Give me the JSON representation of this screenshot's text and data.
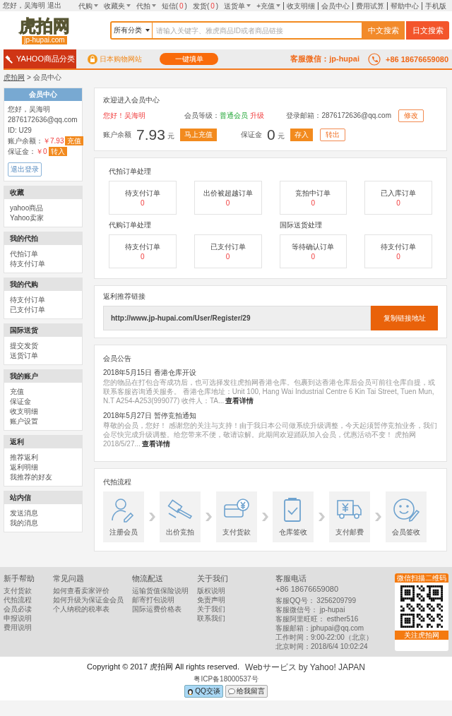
{
  "top_bar": {
    "greeting": "您好，吴海明",
    "logout": "退出",
    "menu": [
      {
        "kind": "dropdown",
        "label": "代购"
      },
      {
        "kind": "dropdown",
        "label": "收藏夹"
      },
      {
        "kind": "dropdown",
        "label": "代拍"
      },
      {
        "kind": "count",
        "label": "短信(",
        "count": "0",
        "close": ")"
      },
      {
        "kind": "count",
        "label": "发货(",
        "count": "0",
        "close": ")"
      },
      {
        "kind": "dropdown",
        "label": "送货单"
      },
      {
        "kind": "dropdown",
        "label": "+充值"
      },
      {
        "kind": "link",
        "label": "收支明细"
      },
      {
        "kind": "link",
        "label": "会员中心"
      },
      {
        "kind": "link",
        "label": "费用试算"
      },
      {
        "kind": "link",
        "label": "帮助中心"
      },
      {
        "kind": "link",
        "label": "手机版"
      }
    ]
  },
  "header": {
    "logo": {
      "name": "虎拍网",
      "domain": "jp-hupai.com"
    },
    "search": {
      "category": "所有分类",
      "placeholder": "请输入关键字、雅虎商品ID或者商品链接",
      "buttons": [
        "中文搜索",
        "日文搜索"
      ]
    }
  },
  "nav": {
    "category_button": "YAHOO商品分类",
    "shop_link": "日本购物网站",
    "quick_button": "一键填单",
    "wechat": "客服微信：jp-hupai",
    "phone": "+86 18676659080"
  },
  "breadcrumb": {
    "items": [
      "虎拍网",
      "会员中心"
    ],
    "separator": ">"
  },
  "sidebar": {
    "profile": {
      "title": "会员中心",
      "greeting": "您好，吴海明",
      "email": "2876172636@qq.com",
      "id": "ID: U29",
      "balance_label": "账户余额：",
      "balance": "￥7.93",
      "recharge": "充值",
      "deposit_label": "保证金：",
      "deposit": "￥0",
      "transfer": "转入",
      "logout": "退出登录"
    },
    "sections": [
      {
        "title": "收藏",
        "items": [
          "yahoo商品",
          "Yahoo卖家"
        ]
      },
      {
        "title": "我的代拍",
        "items": [
          "代拍订单",
          "待支付订单"
        ]
      },
      {
        "title": "我的代购",
        "items": [
          "待支付订单",
          "已支付订单"
        ]
      },
      {
        "title": "国际送货",
        "items": [
          "提交发货",
          "送货订单"
        ]
      },
      {
        "title": "我的账户",
        "items": [
          "充值",
          "保证金",
          "收支明细",
          "账户设置"
        ]
      },
      {
        "title": "返利",
        "items": [
          "推荐返利",
          "返利明细",
          "我推荐的好友"
        ]
      },
      {
        "title": "站内信",
        "items": [
          "发送消息",
          "我的消息"
        ]
      }
    ]
  },
  "welcome": {
    "title": "欢迎进入会员中心",
    "greeting": "您好！吴海明",
    "level_label": "会员等级：",
    "level": "普通会员",
    "upgrade": "升级",
    "email": "登录邮箱：2876172636@qq.com",
    "edit": "修改",
    "balance_label": "账户余额",
    "balance": "7.93",
    "balance_unit": "元",
    "recharge": "马上充值",
    "deposit_label": "保证金",
    "deposit": "0",
    "deposit_unit": "元",
    "deposit_in": "存入",
    "withdraw": "转出"
  },
  "orders": {
    "groups": [
      {
        "title": "代拍订单处理",
        "cards": [
          {
            "label": "待支付订单",
            "count": "0"
          },
          {
            "label": "出价被超越订单",
            "count": "0"
          },
          {
            "label": "竞拍中订单",
            "count": "0"
          },
          {
            "label": "已入库订单",
            "count": "0"
          }
        ]
      },
      {
        "title": "代购订单处理",
        "cards": [
          {
            "label": "待支付订单",
            "count": "0"
          },
          {
            "label": "已支付订单",
            "count": "0"
          }
        ]
      },
      {
        "title": "国际送货处理",
        "cards": [
          {
            "label": "等待确认订单",
            "count": "0"
          },
          {
            "label": "待支付订单",
            "count": "0"
          }
        ]
      }
    ]
  },
  "referral": {
    "title": "返利推荐链接",
    "link": "http://www.jp-hupai.com/User/Register/29",
    "copy_button": "复制链接地址"
  },
  "notices": {
    "title": "会员公告",
    "items": [
      {
        "title": "2018年5月15日 香港仓库开设",
        "body": "您的物品在打包合寄成功后，也可选择发往虎拍网香港仓库。包裹到达香港仓库后会员可前往仓库自提，或联系客服咨询通关服务。 香港仓库地址：Unit 100, Hang Wai Industrial Centre 6 Kin Tai Street, Tuen Mun, N.T A254-A253(999077)  收件人：TA...",
        "more": "查看详情"
      },
      {
        "title": "2018年5月27日 暂停竞拍通知",
        "body": "尊敬的会员，您好！ 感谢您的关注与支持！由于我日本公司做系统升级调整，今天起须暂停竞拍业务，我们会尽快完成升级调整。给您带来不便，敬请谅解。此期间欢迎踊跃加入会员，优惠活动不变！  虎拍网 2018/5/27...",
        "more": "查看详情"
      }
    ]
  },
  "process": {
    "title": "代拍流程",
    "steps": [
      "注册会员",
      "出价竞拍",
      "支付货款",
      "仓库签收",
      "支付邮费",
      "会员签收"
    ]
  },
  "footer": {
    "columns": [
      {
        "title": "新手帮助",
        "links": [
          "支付货款",
          "代拍流程",
          "会员必读",
          "申报说明",
          "费用说明"
        ]
      },
      {
        "title": "常见问题",
        "links": [
          "如何查看卖家评价",
          "如何升级为保证金会员",
          "个人纳税的税率表"
        ]
      },
      {
        "title": "物流配送",
        "links": [
          "运输货值保险说明",
          "邮寄打包说明",
          "国际运费价格表"
        ]
      },
      {
        "title": "关于我们",
        "links": [
          "版权说明",
          "免责声明",
          "关于我们",
          "联系我们"
        ]
      }
    ],
    "contact": {
      "title": "客服电话",
      "phone": "+86 18676659080",
      "lines": [
        "客服QQ号： 3256209799",
        "客服微信号： jp-hupai",
        "客服阿里旺旺： esther516",
        "客服邮箱：jphupai@qq.com",
        "工作时间：9:00-22:00（北京）",
        "北京时间：2018/6/4 10:02:24"
      ]
    },
    "qr": {
      "top": "微信扫描二维码",
      "bottom": "关注虎拍网"
    }
  },
  "copyright": {
    "text": "Copyright © 2017 虎拍网 All rights reserved.",
    "yahoo": "Webサービス by Yahoo! JAPAN",
    "icp": "粤ICP备18000537号",
    "badges": [
      "QQ交谈",
      "给我留言"
    ]
  }
}
